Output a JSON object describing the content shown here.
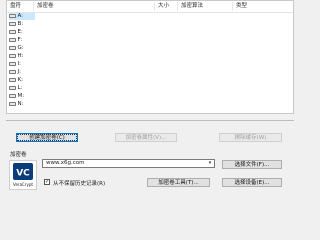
{
  "list": {
    "columns": [
      "盘符",
      "加密卷",
      "大小",
      "加密算法",
      "类型"
    ],
    "drives": [
      "A:",
      "B:",
      "E:",
      "F:",
      "G:",
      "H:",
      "I:",
      "J:",
      "K:",
      "L:",
      "M:",
      "N:"
    ]
  },
  "buttons": {
    "create_volume": "创建加密卷(C)",
    "volume_properties": "加密卷属性(V)...",
    "wipe_cache": "擦除缓存(W)",
    "select_file": "选择文件(F)...",
    "volume_tools": "加密卷工具(T)...",
    "select_device": "选择设备(E)..."
  },
  "volume": {
    "group_label": "加密卷",
    "path_value": "www.x6g.com",
    "never_save_history_label": "从不保留历史记录(R)",
    "never_save_history_checked": true
  },
  "logo": {
    "letters": "VC",
    "name": "VeraCrypt"
  }
}
